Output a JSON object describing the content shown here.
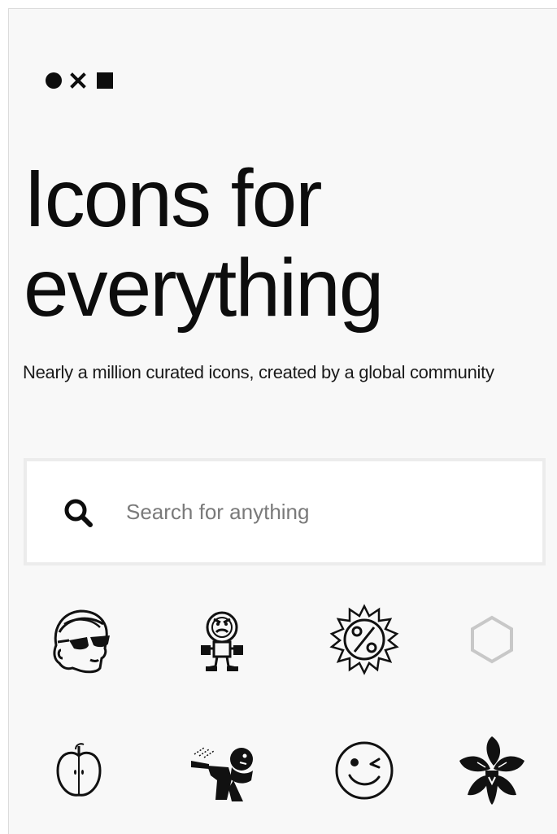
{
  "brand": {
    "logo_icon": "nounproject-logo-icon"
  },
  "hero": {
    "title_line1": "Icons for",
    "title_line2": "everything",
    "subtitle": "Nearly a million curated icons, created by a global community"
  },
  "search": {
    "icon": "search-icon",
    "placeholder": "Search for anything",
    "value": ""
  },
  "icon_grid": {
    "icons": [
      "man-with-sunglasses-icon",
      "angry-robot-icon",
      "percent-sun-badge-icon",
      "hexagon-icon",
      "apple-icon",
      "person-spraying-icon",
      "winking-face-icon",
      "orchid-flower-icon"
    ]
  },
  "colors": {
    "background": "#f8f8f8",
    "text": "#111111",
    "placeholder": "#7a7a7a",
    "hexagon_gray": "#c8c8c8"
  }
}
